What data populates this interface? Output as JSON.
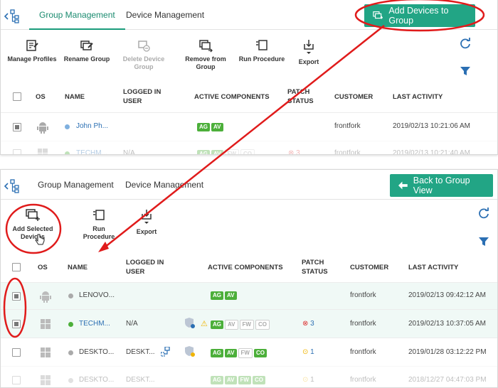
{
  "top": {
    "tabs": [
      {
        "label": "Group Management"
      },
      {
        "label": "Device Management"
      }
    ],
    "action_button": "Add Devices to Group",
    "toolbar": [
      {
        "label": "Manage Profiles"
      },
      {
        "label": "Rename Group"
      },
      {
        "label": "Delete Device Group"
      },
      {
        "label": "Remove from Group"
      },
      {
        "label": "Run Procedure"
      },
      {
        "label": "Export"
      }
    ],
    "columns": [
      "OS",
      "NAME",
      "LOGGED IN USER",
      "ACTIVE COMPONENTS",
      "PATCH STATUS",
      "CUSTOMER",
      "LAST ACTIVITY"
    ],
    "rows": [
      {
        "name": "John Ph...",
        "user": "",
        "customer": "frontfork",
        "last": "2019/02/13 10:21:06 AM",
        "components": [
          "AG",
          "AV"
        ]
      },
      {
        "name": "TECHM...",
        "user": "N/A",
        "patch": "3",
        "customer": "frontfork",
        "last": "2019/02/13 10:21:40 AM",
        "components": [
          "AG",
          "AV",
          "FW",
          "CO"
        ]
      }
    ]
  },
  "bottom": {
    "tabs": [
      {
        "label": "Group Management"
      },
      {
        "label": "Device Management"
      }
    ],
    "action_button": "Back to Group View",
    "toolbar": [
      {
        "label": "Add Selected Devices"
      },
      {
        "label": "Run Procedure"
      },
      {
        "label": "Export"
      }
    ],
    "columns": [
      "OS",
      "NAME",
      "LOGGED IN USER",
      "ACTIVE COMPONENTS",
      "PATCH STATUS",
      "CUSTOMER",
      "LAST ACTIVITY"
    ],
    "rows": [
      {
        "name": "LENOVO...",
        "user": "",
        "patch": "",
        "customer": "frontfork",
        "last": "2019/02/13 09:42:12 AM",
        "components": [
          "AG",
          "AV"
        ]
      },
      {
        "name": "TECHM...",
        "user": "N/A",
        "patch": "3",
        "customer": "frontfork",
        "last": "2019/02/13 10:37:05 AM",
        "components": [
          "AG",
          "AV",
          "FW",
          "CO"
        ]
      },
      {
        "name": "DESKTO...",
        "user": "DESKT...",
        "patch": "1",
        "customer": "frontfork",
        "last": "2019/01/28 03:12:22 PM",
        "components": [
          "AG",
          "AV",
          "FW",
          "CO"
        ]
      },
      {
        "name": "DESKTO...",
        "user": "DESKT...",
        "patch": "1",
        "customer": "frontfork",
        "last": "2018/12/27 04:47:03 PM",
        "components": [
          "AG",
          "AV",
          "FW",
          "CO"
        ]
      }
    ]
  },
  "colors": {
    "accent": "#22a585",
    "annotation": "#e01b1b",
    "link": "#2b6fb3",
    "badge_on": "#4caf3a"
  }
}
